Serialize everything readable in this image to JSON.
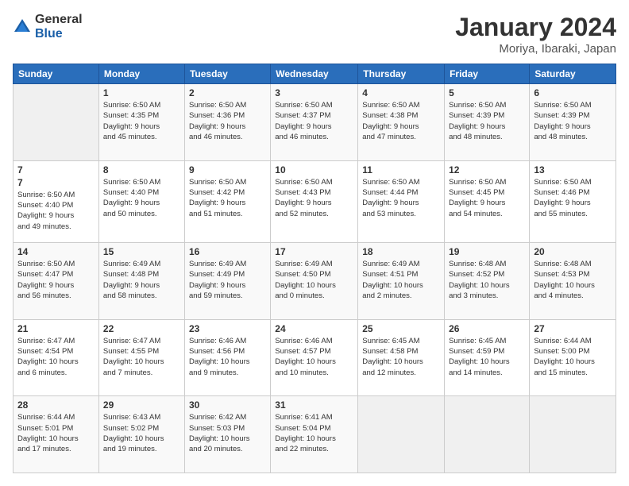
{
  "logo": {
    "general": "General",
    "blue": "Blue"
  },
  "header": {
    "title": "January 2024",
    "subtitle": "Moriya, Ibaraki, Japan"
  },
  "weekdays": [
    "Sunday",
    "Monday",
    "Tuesday",
    "Wednesday",
    "Thursday",
    "Friday",
    "Saturday"
  ],
  "weeks": [
    [
      {
        "day": "",
        "info": ""
      },
      {
        "day": "1",
        "info": "Sunrise: 6:50 AM\nSunset: 4:35 PM\nDaylight: 9 hours\nand 45 minutes."
      },
      {
        "day": "2",
        "info": "Sunrise: 6:50 AM\nSunset: 4:36 PM\nDaylight: 9 hours\nand 46 minutes."
      },
      {
        "day": "3",
        "info": "Sunrise: 6:50 AM\nSunset: 4:37 PM\nDaylight: 9 hours\nand 46 minutes."
      },
      {
        "day": "4",
        "info": "Sunrise: 6:50 AM\nSunset: 4:38 PM\nDaylight: 9 hours\nand 47 minutes."
      },
      {
        "day": "5",
        "info": "Sunrise: 6:50 AM\nSunset: 4:39 PM\nDaylight: 9 hours\nand 48 minutes."
      },
      {
        "day": "6",
        "info": "Sunrise: 6:50 AM\nSunset: 4:39 PM\nDaylight: 9 hours\nand 48 minutes."
      }
    ],
    [
      {
        "day": "7",
        "info": ""
      },
      {
        "day": "8",
        "info": "Sunrise: 6:50 AM\nSunset: 4:40 PM\nDaylight: 9 hours\nand 50 minutes."
      },
      {
        "day": "9",
        "info": "Sunrise: 6:50 AM\nSunset: 4:42 PM\nDaylight: 9 hours\nand 51 minutes."
      },
      {
        "day": "10",
        "info": "Sunrise: 6:50 AM\nSunset: 4:43 PM\nDaylight: 9 hours\nand 52 minutes."
      },
      {
        "day": "11",
        "info": "Sunrise: 6:50 AM\nSunset: 4:44 PM\nDaylight: 9 hours\nand 53 minutes."
      },
      {
        "day": "12",
        "info": "Sunrise: 6:50 AM\nSunset: 4:45 PM\nDaylight: 9 hours\nand 54 minutes."
      },
      {
        "day": "13",
        "info": "Sunrise: 6:50 AM\nSunset: 4:46 PM\nDaylight: 9 hours\nand 55 minutes."
      }
    ],
    [
      {
        "day": "14",
        "info": "Sunrise: 6:50 AM\nSunset: 4:47 PM\nDaylight: 9 hours\nand 56 minutes."
      },
      {
        "day": "15",
        "info": "Sunrise: 6:49 AM\nSunset: 4:48 PM\nDaylight: 9 hours\nand 58 minutes."
      },
      {
        "day": "16",
        "info": "Sunrise: 6:49 AM\nSunset: 4:49 PM\nDaylight: 9 hours\nand 59 minutes."
      },
      {
        "day": "17",
        "info": "Sunrise: 6:49 AM\nSunset: 4:50 PM\nDaylight: 10 hours\nand 0 minutes."
      },
      {
        "day": "18",
        "info": "Sunrise: 6:49 AM\nSunset: 4:51 PM\nDaylight: 10 hours\nand 2 minutes."
      },
      {
        "day": "19",
        "info": "Sunrise: 6:48 AM\nSunset: 4:52 PM\nDaylight: 10 hours\nand 3 minutes."
      },
      {
        "day": "20",
        "info": "Sunrise: 6:48 AM\nSunset: 4:53 PM\nDaylight: 10 hours\nand 4 minutes."
      }
    ],
    [
      {
        "day": "21",
        "info": "Sunrise: 6:47 AM\nSunset: 4:54 PM\nDaylight: 10 hours\nand 6 minutes."
      },
      {
        "day": "22",
        "info": "Sunrise: 6:47 AM\nSunset: 4:55 PM\nDaylight: 10 hours\nand 7 minutes."
      },
      {
        "day": "23",
        "info": "Sunrise: 6:46 AM\nSunset: 4:56 PM\nDaylight: 10 hours\nand 9 minutes."
      },
      {
        "day": "24",
        "info": "Sunrise: 6:46 AM\nSunset: 4:57 PM\nDaylight: 10 hours\nand 10 minutes."
      },
      {
        "day": "25",
        "info": "Sunrise: 6:45 AM\nSunset: 4:58 PM\nDaylight: 10 hours\nand 12 minutes."
      },
      {
        "day": "26",
        "info": "Sunrise: 6:45 AM\nSunset: 4:59 PM\nDaylight: 10 hours\nand 14 minutes."
      },
      {
        "day": "27",
        "info": "Sunrise: 6:44 AM\nSunset: 5:00 PM\nDaylight: 10 hours\nand 15 minutes."
      }
    ],
    [
      {
        "day": "28",
        "info": "Sunrise: 6:44 AM\nSunset: 5:01 PM\nDaylight: 10 hours\nand 17 minutes."
      },
      {
        "day": "29",
        "info": "Sunrise: 6:43 AM\nSunset: 5:02 PM\nDaylight: 10 hours\nand 19 minutes."
      },
      {
        "day": "30",
        "info": "Sunrise: 6:42 AM\nSunset: 5:03 PM\nDaylight: 10 hours\nand 20 minutes."
      },
      {
        "day": "31",
        "info": "Sunrise: 6:41 AM\nSunset: 5:04 PM\nDaylight: 10 hours\nand 22 minutes."
      },
      {
        "day": "",
        "info": ""
      },
      {
        "day": "",
        "info": ""
      },
      {
        "day": "",
        "info": ""
      }
    ]
  ]
}
